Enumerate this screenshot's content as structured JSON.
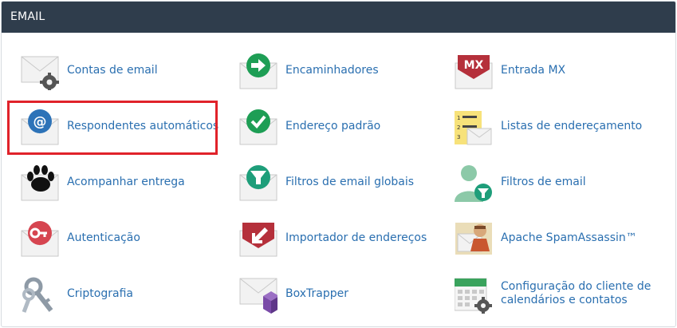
{
  "panel": {
    "title": "EMAIL"
  },
  "items": [
    {
      "label": "Contas de email",
      "icon": "envelope-gear-icon"
    },
    {
      "label": "Encaminhadores",
      "icon": "forward-arrow-icon"
    },
    {
      "label": "Entrada MX",
      "icon": "mx-envelope-icon",
      "badge": "MX"
    },
    {
      "label": "Respondentes automáticos",
      "icon": "at-sign-envelope-icon"
    },
    {
      "label": "Endereço padrão",
      "icon": "checkmark-envelope-icon"
    },
    {
      "label": "Listas de endereçamento",
      "icon": "mailing-list-icon"
    },
    {
      "label": "Acompanhar entrega",
      "icon": "paw-print-icon"
    },
    {
      "label": "Filtros de email globais",
      "icon": "global-filter-icon"
    },
    {
      "label": "Filtros de email",
      "icon": "user-filter-icon"
    },
    {
      "label": "Autenticação",
      "icon": "key-envelope-icon"
    },
    {
      "label": "Importador de endereços",
      "icon": "import-arrow-icon"
    },
    {
      "label": "Apache SpamAssassin™",
      "icon": "spamassassin-icon"
    },
    {
      "label": "Criptografia",
      "icon": "keys-icon"
    },
    {
      "label": "BoxTrapper",
      "icon": "envelope-box-icon"
    },
    {
      "label": "Configuração do cliente de",
      "label2": "calendários e contatos",
      "icon": "calendar-gear-icon"
    }
  ],
  "colors": {
    "header_bg": "#2f3d4c",
    "link": "#2a6fb0",
    "highlight": "#e0222a"
  }
}
